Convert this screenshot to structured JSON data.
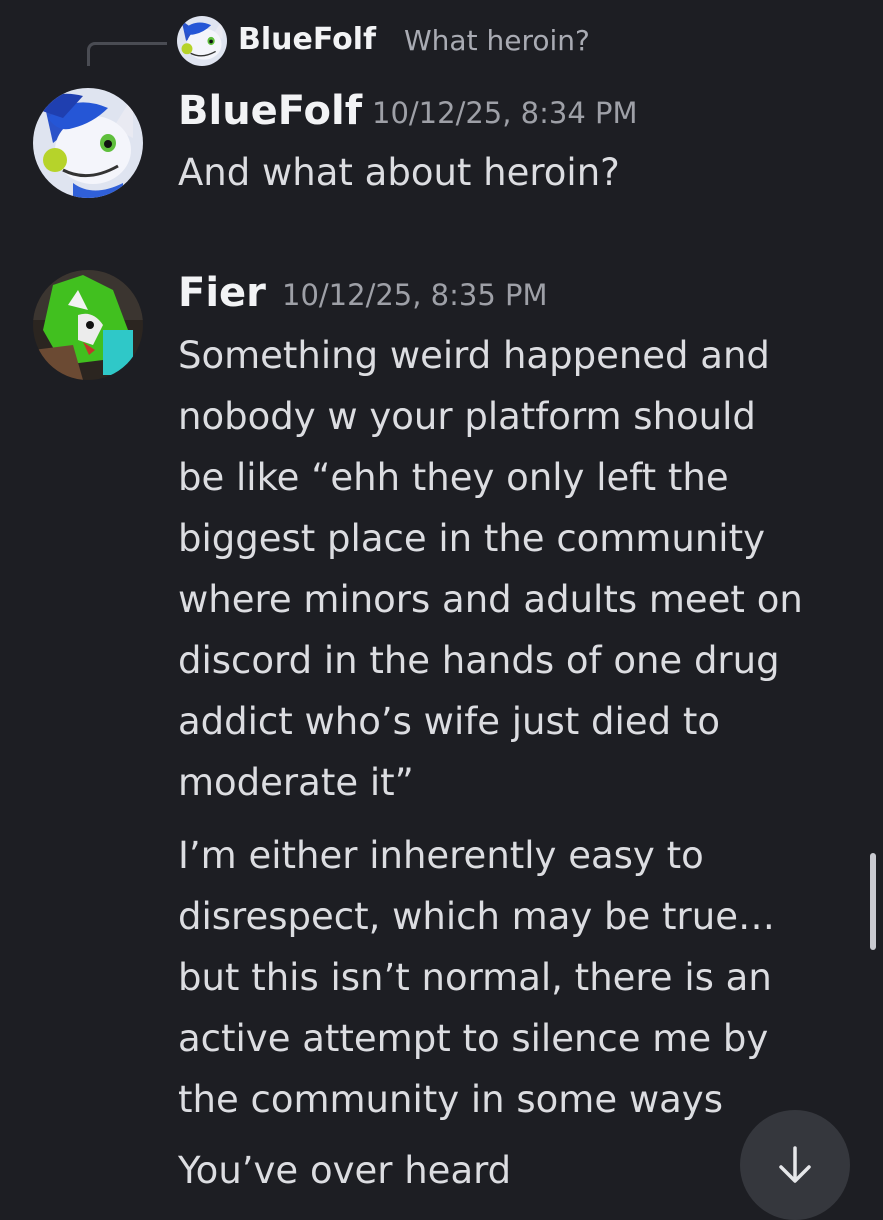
{
  "reply": {
    "username": "BlueFolf",
    "text": "What heroin?"
  },
  "messages": [
    {
      "username": "BlueFolf",
      "timestamp": "10/12/25, 8:34 PM",
      "paragraphs": [
        "And what about heroin?"
      ]
    },
    {
      "username": "Fier",
      "timestamp": "10/12/25, 8:35 PM",
      "paragraphs": [
        "Something weird happened and\nnobody w your platform should\nbe like “ehh they only left the\nbiggest place in the community\nwhere minors and adults meet on\ndiscord in the hands of one drug\naddict who’s wife just died to\nmoderate it”",
        "I’m either inherently easy to\ndisrespect, which may be true…\nbut this isn’t normal, there is an\nactive attempt to silence me by\nthe community in some ways",
        "You’ve over heard"
      ]
    }
  ],
  "icons": {
    "jump_button": "arrow-down-icon"
  },
  "colors": {
    "background": "#1d1e23",
    "username": "#f2f3f5",
    "text": "#dcdde1",
    "timestamp": "#9ea0a7"
  }
}
